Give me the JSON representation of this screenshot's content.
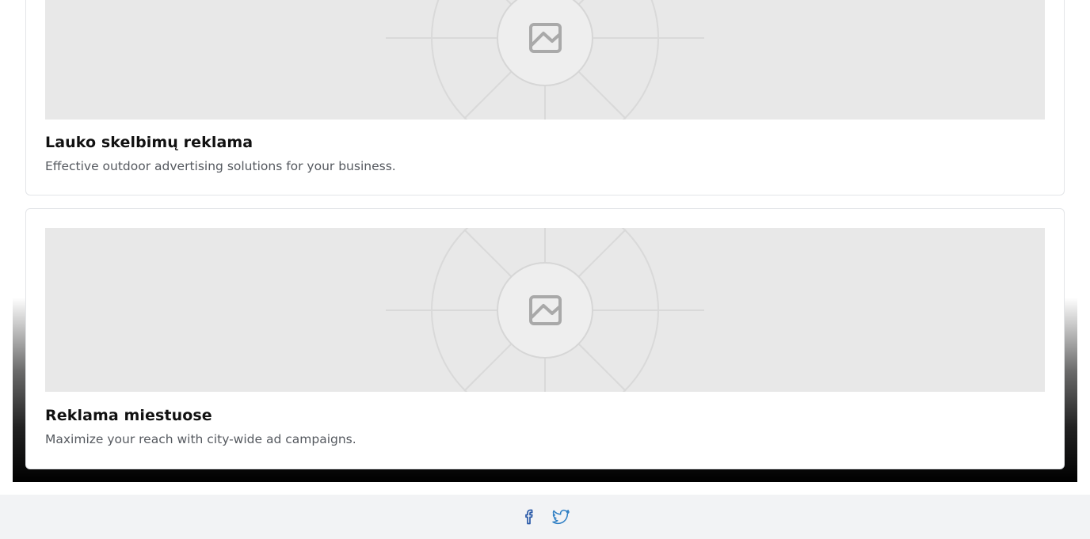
{
  "cards": [
    {
      "title": "Lauko skelbimų reklama",
      "description": "Effective outdoor advertising solutions for your business.",
      "image_icon": "image-placeholder-icon"
    },
    {
      "title": "Reklama miestuose",
      "description": "Maximize your reach with city-wide ad campaigns.",
      "image_icon": "image-placeholder-icon"
    }
  ],
  "footer": {
    "social_links": [
      {
        "icon": "facebook-icon",
        "color": "#2b5aa8"
      },
      {
        "icon": "twitter-icon",
        "color": "#2f7fc4"
      }
    ]
  },
  "colors": {
    "placeholder_bg": "#e8e8e8",
    "placeholder_lines": "#d9d9d9",
    "placeholder_icon": "#a9a9a9",
    "footer_bg": "#f2f3f5"
  }
}
